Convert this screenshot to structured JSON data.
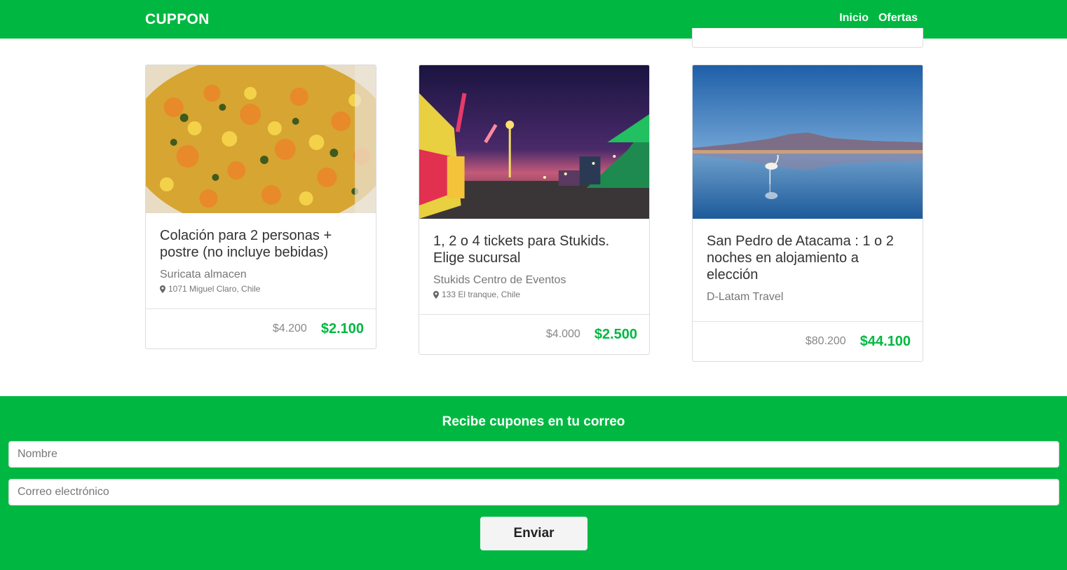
{
  "nav": {
    "brand": "CUPPON",
    "links": [
      "Inicio",
      "Ofertas"
    ]
  },
  "deals": [
    {
      "title": "Colación para 2 personas + postre (no incluye bebidas)",
      "merchant": "Suricata almacen",
      "address": "1071 Miguel Claro, Chile",
      "old_price": "$4.200",
      "new_price": "$2.100",
      "image": "food-dish"
    },
    {
      "title": "1, 2 o 4 tickets para Stukids. Elige sucursal",
      "merchant": "Stukids Centro de Eventos",
      "address": "133 El tranque, Chile",
      "old_price": "$4.000",
      "new_price": "$2.500",
      "image": "fairground-night"
    },
    {
      "title": "San Pedro de Atacama : 1 o 2 noches en alojamiento a elección",
      "merchant": "D-Latam Travel",
      "address": "",
      "old_price": "$80.200",
      "new_price": "$44.100",
      "image": "flamingo-lake"
    }
  ],
  "newsletter": {
    "title": "Recibe cupones en tu correo",
    "name_placeholder": "Nombre",
    "email_placeholder": "Correo electrónico",
    "submit_label": "Enviar"
  },
  "colors": {
    "brand_green": "#00b841",
    "price_green": "#00b841"
  }
}
